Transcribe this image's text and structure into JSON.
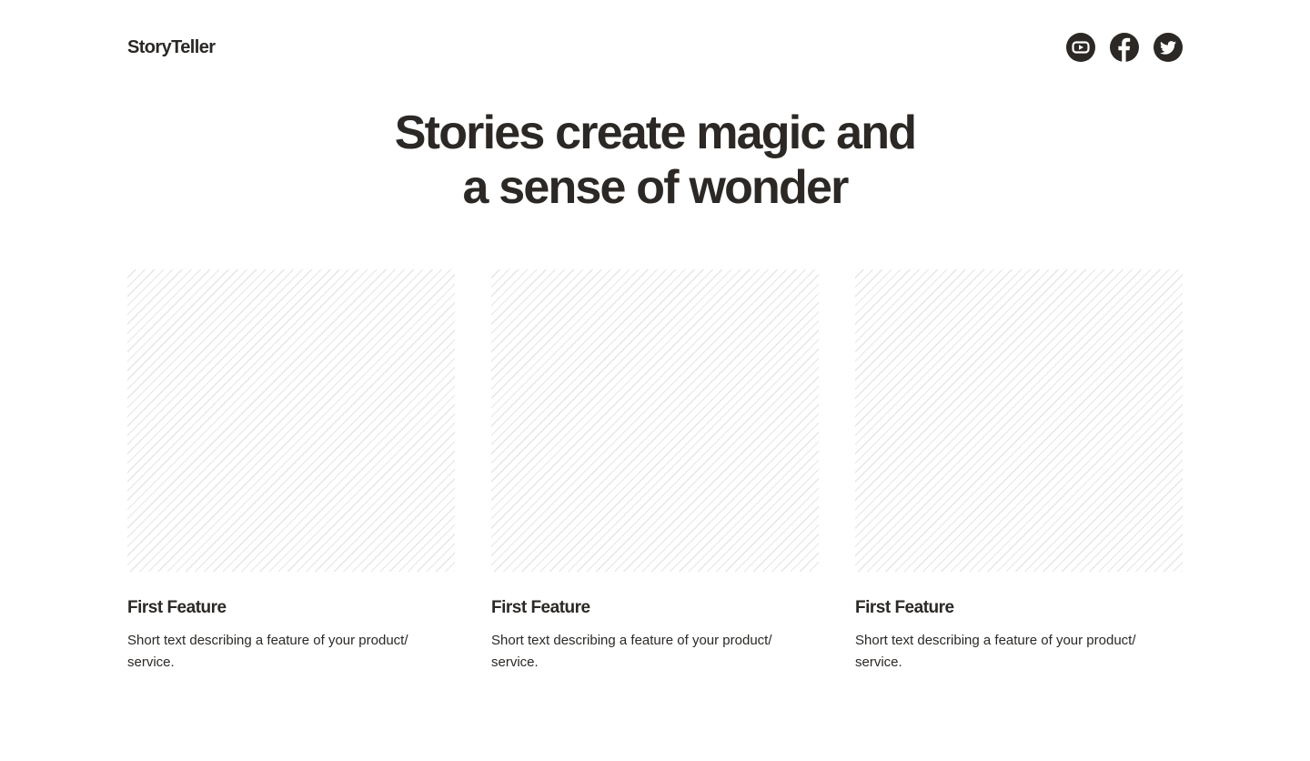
{
  "header": {
    "brand": "StoryTeller",
    "socials": [
      {
        "name": "youtube",
        "icon": "youtube-icon"
      },
      {
        "name": "facebook",
        "icon": "facebook-icon"
      },
      {
        "name": "twitter",
        "icon": "twitter-icon"
      }
    ]
  },
  "hero": {
    "line1": "Stories create magic and",
    "line2": "a sense of wonder"
  },
  "features": [
    {
      "title": "First Feature",
      "text": "Short text describing a feature of your product/ service."
    },
    {
      "title": "First Feature",
      "text": "Short text describing a feature of your product/ service."
    },
    {
      "title": "First Feature",
      "text": "Short text describing a feature of your product/ service."
    }
  ],
  "colors": {
    "text": "#2b2825",
    "background": "#ffffff",
    "stripe": "#e6e6e6"
  }
}
